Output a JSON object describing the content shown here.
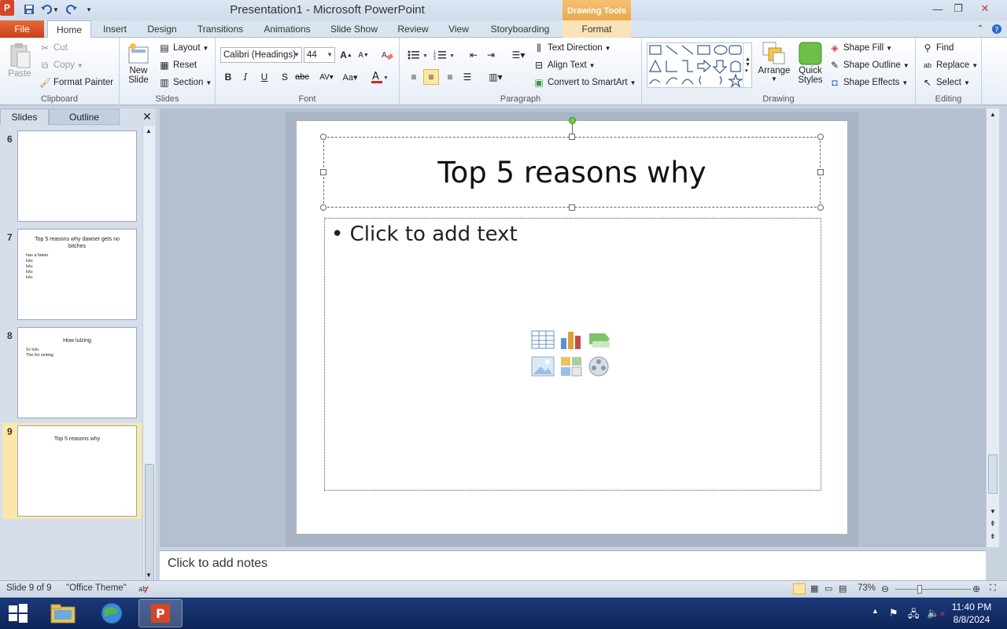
{
  "titlebar": {
    "title": "Presentation1  -  Microsoft PowerPoint",
    "contextual_tab": "Drawing Tools",
    "app_icon_letter": "P"
  },
  "tabs": [
    "File",
    "Home",
    "Insert",
    "Design",
    "Transitions",
    "Animations",
    "Slide Show",
    "Review",
    "View",
    "Storyboarding",
    "Format"
  ],
  "ribbon": {
    "clipboard": {
      "paste": "Paste",
      "cut": "Cut",
      "copy": "Copy",
      "format_painter": "Format Painter",
      "label": "Clipboard"
    },
    "slides": {
      "new_slide": "New",
      "new_slide_2": "Slide",
      "layout": "Layout",
      "reset": "Reset",
      "section": "Section",
      "label": "Slides"
    },
    "font": {
      "font_name": "Calibri (Headings)",
      "font_size": "44",
      "label": "Font"
    },
    "paragraph": {
      "text_direction": "Text Direction",
      "align_text": "Align Text",
      "convert_smartart": "Convert to SmartArt",
      "label": "Paragraph"
    },
    "drawing": {
      "arrange": "Arrange",
      "quick_styles_1": "Quick",
      "quick_styles_2": "Styles",
      "shape_fill": "Shape Fill",
      "shape_outline": "Shape Outline",
      "shape_effects": "Shape Effects",
      "label": "Drawing"
    },
    "editing": {
      "find": "Find",
      "replace": "Replace",
      "select": "Select",
      "label": "Editing"
    }
  },
  "pane": {
    "tab_slides": "Slides",
    "tab_outline": "Outline",
    "thumbnails": [
      {
        "number": "6",
        "title": "",
        "lines": []
      },
      {
        "number": "7",
        "title": "Top 5 reasons why dawser gets no bitches",
        "lines": [
          "has a fatwo",
          "lulu",
          "lulu",
          "lulu",
          "lulu"
        ]
      },
      {
        "number": "8",
        "title": "How lulzing",
        "lines": [
          "1x lulu",
          "The for writing"
        ]
      },
      {
        "number": "9",
        "title": "Top 5 reasons why",
        "lines": []
      }
    ]
  },
  "slide": {
    "title": "Top 5 reasons why",
    "bullet": "•",
    "content_placeholder": "Click to add text"
  },
  "notes": {
    "placeholder": "Click to add notes"
  },
  "status": {
    "slide_info": "Slide 9 of 9",
    "theme": "\"Office Theme\"",
    "zoom": "73%"
  },
  "taskbar": {
    "time": "11:40 PM",
    "date": "8/8/2024"
  },
  "colors": {
    "file_tab": "#d24726",
    "selected_thumb": "#fde7a8",
    "taskbar": "#1b3a7a"
  }
}
